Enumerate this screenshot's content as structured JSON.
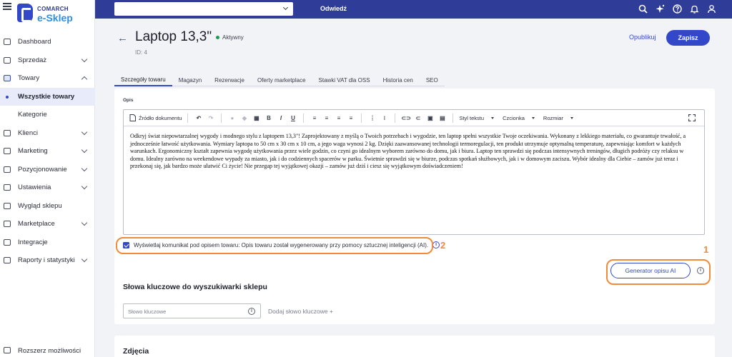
{
  "brand": {
    "small": "COMARCH",
    "big": "e-Sklep",
    "accent": "#3348c9",
    "topbar_color": "#2f3c98"
  },
  "sidebar": {
    "items": [
      {
        "label": "Dashboard",
        "icon": "dashboard-icon"
      },
      {
        "label": "Sprzedaż",
        "icon": "cart-icon"
      },
      {
        "label": "Towary",
        "icon": "box-icon"
      },
      {
        "label": "Wszystkie towary"
      },
      {
        "label": "Kategorie"
      },
      {
        "label": "Klienci",
        "icon": "users-icon"
      },
      {
        "label": "Marketing",
        "icon": "star-icon"
      },
      {
        "label": "Pozycjonowanie",
        "icon": "trend-icon"
      },
      {
        "label": "Ustawienia",
        "icon": "gear-icon"
      },
      {
        "label": "Wygląd sklepu",
        "icon": "palette-icon"
      },
      {
        "label": "Marketplace",
        "icon": "store-icon"
      },
      {
        "label": "Integracje",
        "icon": "plug-icon"
      },
      {
        "label": "Raporty i statystyki",
        "icon": "chart-icon"
      }
    ],
    "bottom": "Rozszerz możliwości"
  },
  "topbar": {
    "select_value": "",
    "go_label": "Odwiedź",
    "icons": [
      "search-icon",
      "sparkle-icon",
      "help-icon",
      "bell-icon",
      "user-icon"
    ]
  },
  "header": {
    "back": "←",
    "title": "Laptop 13,3\"",
    "status": "Aktywny",
    "id": "ID: 4",
    "publish": "Opublikuj",
    "save": "Zapisz"
  },
  "tabs": [
    "Szczegóły towaru",
    "Magazyn",
    "Rezerwacje",
    "Oferty marketplace",
    "Stawki VAT dla OSS",
    "Historia cen",
    "SEO"
  ],
  "description": {
    "label": "Opis",
    "toolbar": {
      "source": "Źródło dokumentu",
      "bold": "B",
      "italic": "I",
      "underline": "U",
      "style": "Styl tekstu",
      "font": "Czcionka",
      "size": "Rozmiar"
    },
    "text": "Odkryj świat niepowtarzalnej wygody i modnego stylu z laptopem 13,3\"! Zaprojektowany z myślą o Twoich potrzebach i wygodzie, ten laptop spełni wszystkie Twoje oczekiwania. Wykonany z lekkiego materiału, co gwarantuje trwałość, a jednocześnie łatwość użytkowania. Wymiary laptopa to 50 cm x 30 cm x 10 cm, a jego waga wynosi 2 kg. Dzięki zaawansowanej technologii termoregulacji, ten produkt utrzymuje optymalną temperaturę, zapewniając komfort w każdych warunkach. Ergonomiczny kształt zapewnia wygodę użytkowania przez wiele godzin, co czyni go idealnym wyborem zarówno do domu, jak i biura. Laptop ten sprawdzi się podczas intensywnych treningów, długich podróży czy relaksu w domu. Idealny zarówno na weekendowe wypady za miasto, jak i do codziennych spacerów w parku. Świetnie sprawdzi się w biurze, podczas spotkań służbowych, jak i w domowym zaciszu. Wybór idealny dla Ciebie – zamów już teraz i przekonaj się, jak bardzo może ułatwić Ci życie! Nie przegap tej wyjątkowej okazji – zamów już dziś i ciesz się wyjątkowym doświadczeniem!"
  },
  "ai_notice": {
    "checked": true,
    "text": "Wyświetlaj komunikat pod opisem towaru: Opis towaru został wygenerowany przy pomocy sztucznej inteligencji (AI).",
    "marker": "2"
  },
  "generator": {
    "label": "Generator opisu AI",
    "marker": "1"
  },
  "keywords": {
    "title": "Słowa kluczowe do wyszukiwarki sklepu",
    "placeholder": "Słowo kluczowe",
    "add": "Dodaj słowo kluczowe +"
  },
  "photos": {
    "title": "Zdjęcia"
  },
  "highlight_color": "#f08a3c"
}
